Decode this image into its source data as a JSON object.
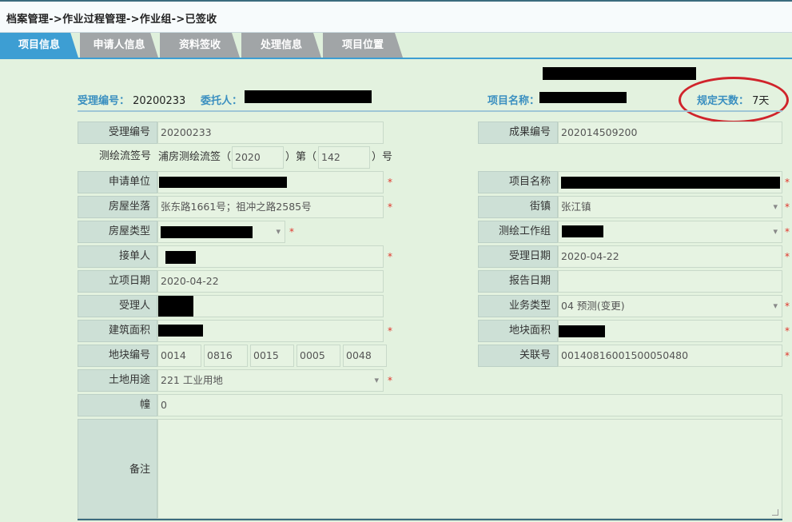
{
  "breadcrumb": "档案管理->作业过程管理->作业组->已签收",
  "tabs": [
    "项目信息",
    "申请人信息",
    "资料签收",
    "处理信息",
    "项目位置"
  ],
  "summary": {
    "accept_no_label": "受理编号：",
    "accept_no_value": "20200233",
    "client_label": "委托人：",
    "project_name_label": "项目名称：",
    "days_label": "规定天数：",
    "days_value": "7天"
  },
  "form": {
    "accept_no": {
      "label": "受理编号",
      "value": "20200233"
    },
    "result_no": {
      "label": "成果编号",
      "value": "202014509200"
    },
    "survey_tag": {
      "label": "测绘流签号",
      "prefix": "浦房测绘流签（",
      "year": "2020",
      "mid": "）第（",
      "num": "142",
      "suffix": "）号"
    },
    "applicant_unit": {
      "label": "申请单位"
    },
    "project_name": {
      "label": "项目名称"
    },
    "house_location": {
      "label": "房屋坐落",
      "value": "张东路1661号；祖冲之路2585号"
    },
    "street": {
      "label": "街镇",
      "value": "张江镇"
    },
    "house_type": {
      "label": "房屋类型"
    },
    "survey_group": {
      "label": "测绘工作组"
    },
    "receiver": {
      "label": "接单人"
    },
    "accept_date": {
      "label": "受理日期",
      "value": "2020-04-22"
    },
    "setup_date": {
      "label": "立项日期",
      "value": "2020-04-22"
    },
    "report_date": {
      "label": "报告日期",
      "value": ""
    },
    "acceptor": {
      "label": "受理人"
    },
    "biz_type": {
      "label": "业务类型",
      "value": "04 预测(变更)"
    },
    "build_area": {
      "label": "建筑面积"
    },
    "plot_area": {
      "label": "地块面积"
    },
    "plot_no": {
      "label": "地块编号",
      "parts": [
        "0014",
        "0816",
        "0015",
        "0005",
        "0048"
      ]
    },
    "relation_no": {
      "label": "关联号",
      "value": "00140816001500050480"
    },
    "land_use": {
      "label": "土地用途",
      "value": "221 工业用地"
    },
    "building": {
      "label": "幢",
      "value": "0"
    },
    "remark": {
      "label": "备注",
      "value": ""
    }
  },
  "required_mark": "*",
  "colors": {
    "tab_active": "#3d9ed3",
    "tab_inactive": "#a1a5a7",
    "required": "#e0352b",
    "annotation_circle": "#d0242b",
    "label_blue": "#3a8fc0"
  }
}
